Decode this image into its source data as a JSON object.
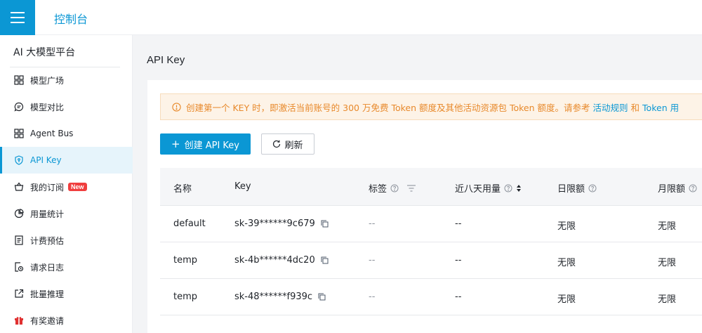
{
  "header": {
    "title": "控制台"
  },
  "sidebar": {
    "platform_title": "AI 大模型平台",
    "items": [
      {
        "label": "模型广场",
        "icon": "grid-icon"
      },
      {
        "label": "模型对比",
        "icon": "chat-icon"
      },
      {
        "label": "Agent Bus",
        "icon": "grid-icon"
      },
      {
        "label": "API Key",
        "icon": "shield-key-icon",
        "active": true
      },
      {
        "label": "我的订阅",
        "icon": "basket-icon",
        "badge": "New"
      },
      {
        "label": "用量统计",
        "icon": "pie-chart-icon"
      },
      {
        "label": "计费预估",
        "icon": "document-icon"
      },
      {
        "label": "请求日志",
        "icon": "clock-file-icon"
      },
      {
        "label": "批量推理",
        "icon": "export-icon"
      },
      {
        "label": "有奖邀请",
        "icon": "gift-icon"
      }
    ]
  },
  "page": {
    "title": "API Key"
  },
  "notice": {
    "text": "创建第一个 KEY 时，即激活当前账号的 300 万免费 Token 额度及其他活动资源包 Token 额度。请参考",
    "link1": "活动规则",
    "and": "和",
    "link2": "Token 用"
  },
  "actions": {
    "create_label": "创建 API Key",
    "refresh_label": "刷新"
  },
  "table": {
    "columns": [
      "名称",
      "Key",
      "标签",
      "近八天用量",
      "日限额",
      "月限额"
    ],
    "rows": [
      {
        "name": "default",
        "key": "sk-39******9c679",
        "tags": "--",
        "usage": "--",
        "daily_limit": "无限",
        "monthly_limit": "无限"
      },
      {
        "name": "temp",
        "key": "sk-4b******4dc20",
        "tags": "--",
        "usage": "--",
        "daily_limit": "无限",
        "monthly_limit": "无限"
      },
      {
        "name": "temp",
        "key": "sk-48******f939c",
        "tags": "--",
        "usage": "--",
        "daily_limit": "无限",
        "monthly_limit": "无限"
      }
    ]
  },
  "colors": {
    "accent": "#0b97d4",
    "warning": "#e8892b",
    "badge": "#f03e3e"
  }
}
